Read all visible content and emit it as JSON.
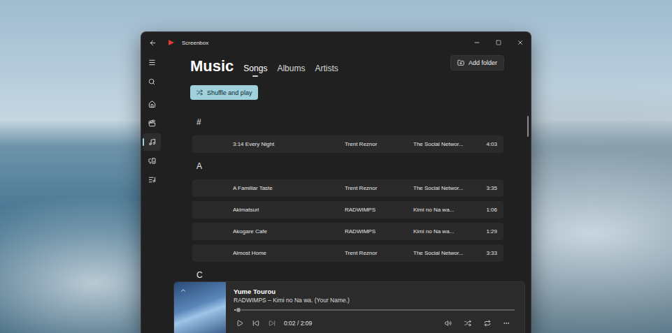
{
  "window": {
    "title": "Screenbox"
  },
  "nav": {
    "items": [
      {
        "selected": false
      },
      {
        "selected": false
      },
      {
        "selected": true
      },
      {
        "selected": false
      },
      {
        "selected": false
      }
    ]
  },
  "page": {
    "title": "Music",
    "tabs": [
      {
        "label": "Songs",
        "selected": true
      },
      {
        "label": "Albums",
        "selected": false
      },
      {
        "label": "Artists",
        "selected": false
      }
    ],
    "add_folder": "Add folder",
    "shuffle": "Shuffle and play"
  },
  "groups": [
    {
      "letter": "#",
      "rows": [
        {
          "title": "3:14 Every Night",
          "artist": "Trent Reznor",
          "album": "The Social Networ...",
          "duration": "4:03"
        }
      ]
    },
    {
      "letter": "A",
      "rows": [
        {
          "title": "A Familiar Taste",
          "artist": "Trent Reznor",
          "album": "The Social Networ...",
          "duration": "3:35"
        },
        {
          "title": "Akimatsuri",
          "artist": "RADWIMPS",
          "album": "Kimi no Na wa...",
          "duration": "1:06"
        },
        {
          "title": "Akogare Cafe",
          "artist": "RADWIMPS",
          "album": "Kimi no Na wa...",
          "duration": "1:29"
        },
        {
          "title": "Almost Home",
          "artist": "Trent Reznor",
          "album": "The Social Networ...",
          "duration": "3:33"
        }
      ]
    },
    {
      "letter": "C",
      "rows": []
    }
  ],
  "now_playing": {
    "title": "Yume Tourou",
    "subtitle": "RADWIMPS – Kimi no Na wa. (Your Name.)",
    "level": 0.016,
    "time": "0:02 / 2:09"
  }
}
